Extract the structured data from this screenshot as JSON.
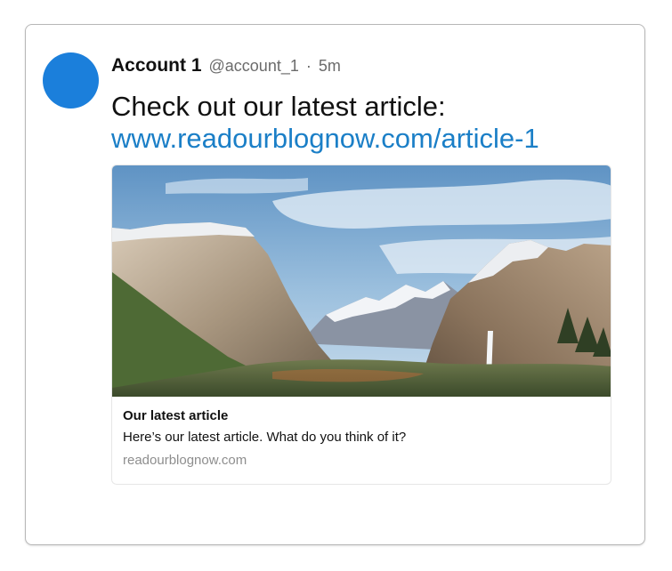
{
  "tweet": {
    "account_name": "Account 1",
    "handle": "@account_1",
    "separator": "·",
    "time": "5m",
    "text": "Check out our latest article:",
    "link_text": "www.readourblognow.com/article-1",
    "avatar_color": "#1b7fdb",
    "link_color": "#1b7fc7"
  },
  "link_card": {
    "title": "Our latest article",
    "description": "Here’s our latest article. What do you think of it?",
    "domain": "readourblognow.com"
  }
}
